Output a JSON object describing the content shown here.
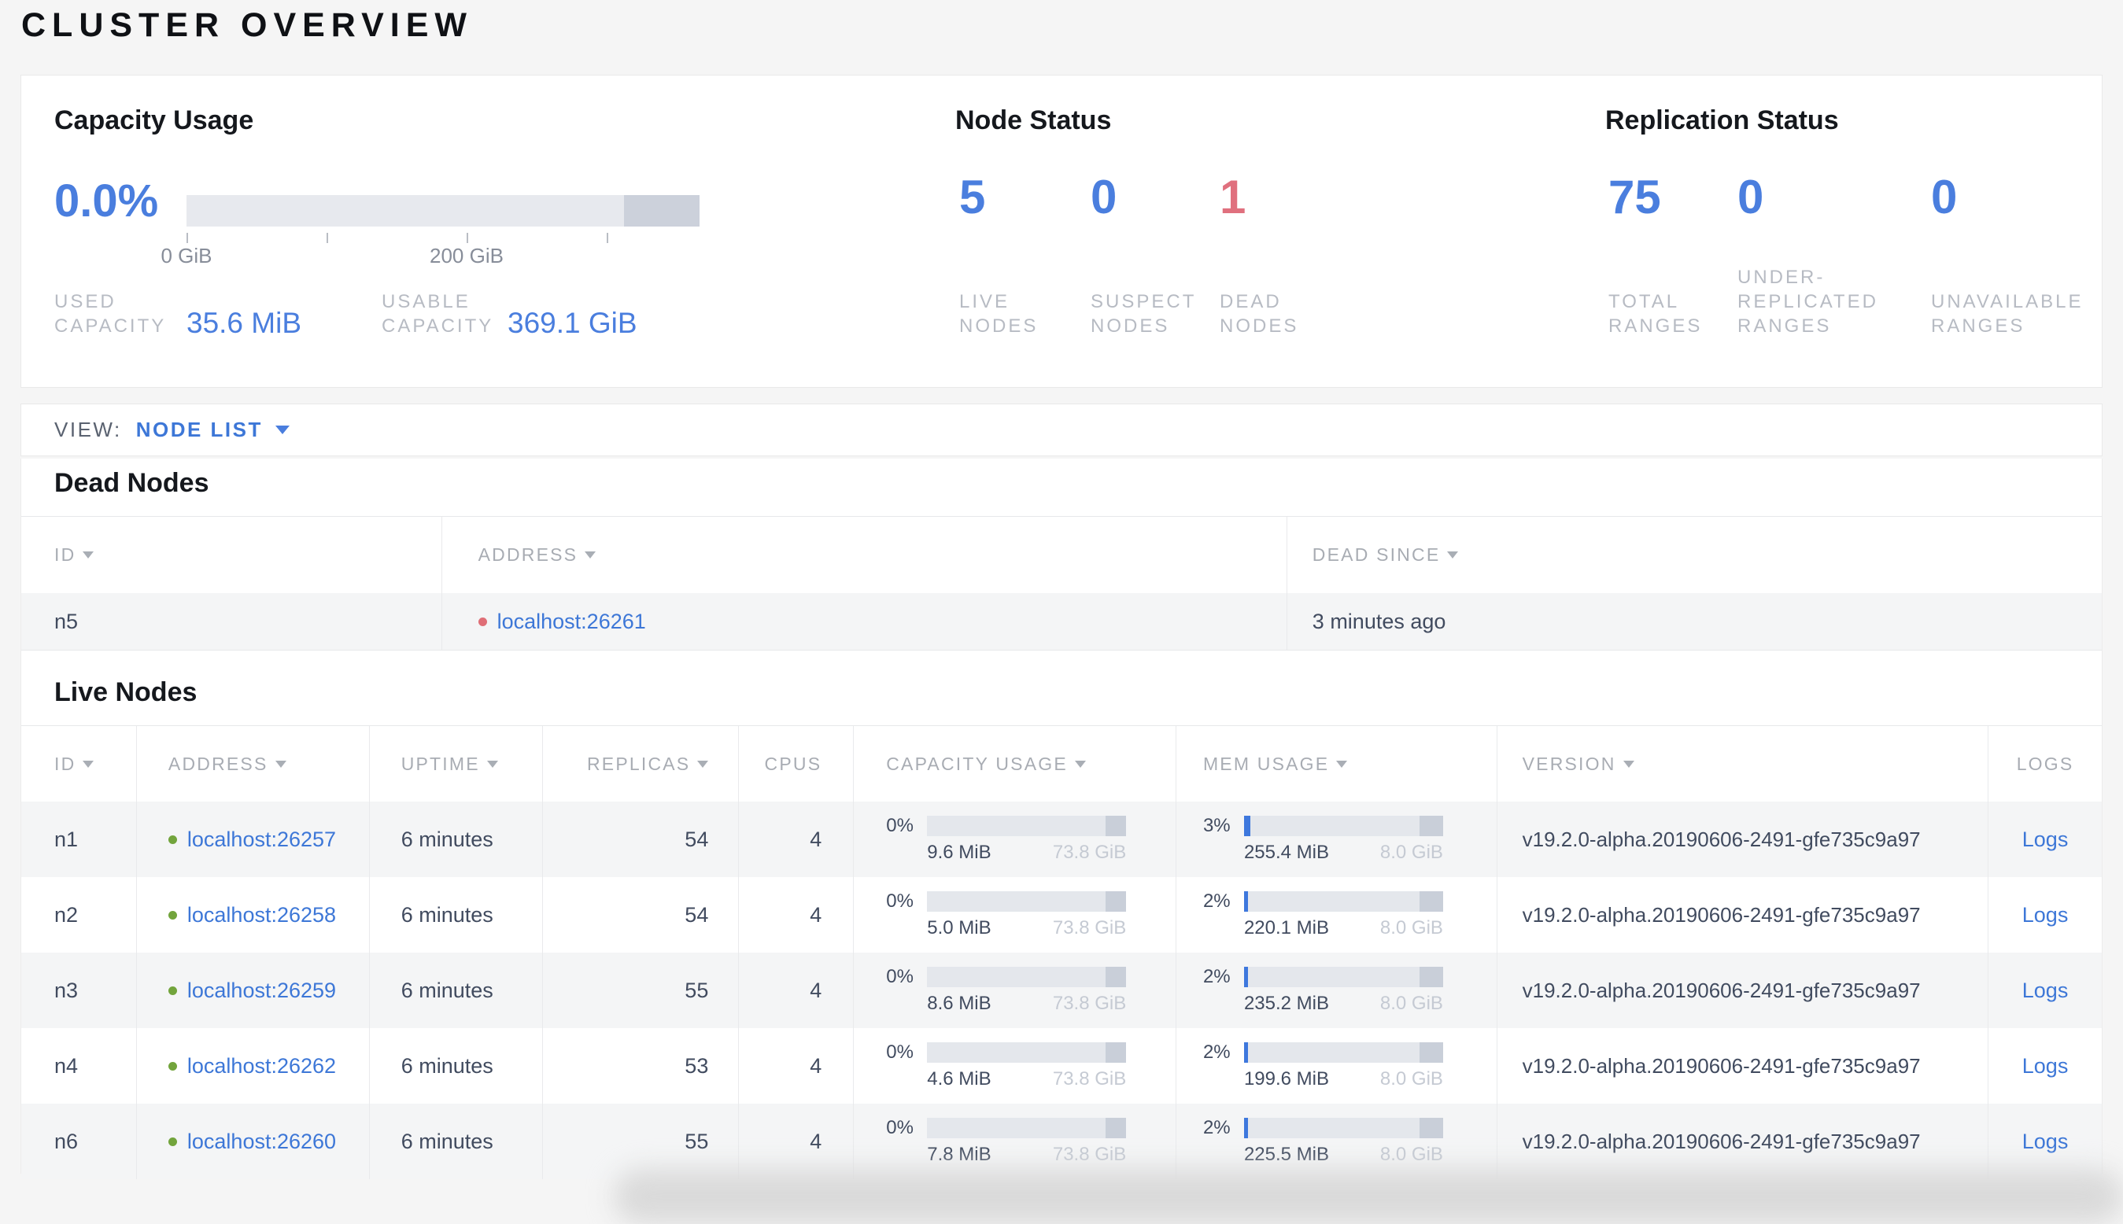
{
  "page_title": "CLUSTER OVERVIEW",
  "colors": {
    "accent_blue": "#4a7ede",
    "link_blue": "#3d77d7",
    "danger_red": "#e0707e",
    "live_green": "#72a43c",
    "bar_track": "#e4e7ec",
    "bar_dark_segment": "#ccd1db",
    "bar_fill_blue": "#3e78dd",
    "page_background": "#f5f5f5",
    "card_background": "#ffffff"
  },
  "summary": {
    "capacity": {
      "title": "Capacity Usage",
      "percent": "0.0%",
      "tick_labels": [
        "0 GiB",
        "200 GiB"
      ],
      "used_label": "USED CAPACITY",
      "used_value": "35.6 MiB",
      "usable_label": "USABLE CAPACITY",
      "usable_value": "369.1 GiB"
    },
    "node_status": {
      "title": "Node Status",
      "live": {
        "value": "5",
        "label": "LIVE NODES"
      },
      "suspect": {
        "value": "0",
        "label": "SUSPECT NODES"
      },
      "dead": {
        "value": "1",
        "label": "DEAD NODES"
      }
    },
    "replication": {
      "title": "Replication Status",
      "total": {
        "value": "75",
        "label": "TOTAL RANGES"
      },
      "under_replicated": {
        "value": "0",
        "label": "UNDER-REPLICATED RANGES"
      },
      "unavailable": {
        "value": "0",
        "label": "UNAVAILABLE RANGES"
      }
    }
  },
  "view_bar": {
    "label": "VIEW:",
    "selected": "NODE LIST"
  },
  "dead_nodes": {
    "title": "Dead Nodes",
    "columns": {
      "id": "ID",
      "address": "ADDRESS",
      "dead_since": "DEAD SINCE"
    },
    "rows": [
      {
        "id": "n5",
        "address": "localhost:26261",
        "dead_since": "3 minutes ago"
      }
    ]
  },
  "live_nodes": {
    "title": "Live Nodes",
    "columns": {
      "id": "ID",
      "address": "ADDRESS",
      "uptime": "UPTIME",
      "replicas": "REPLICAS",
      "cpus": "CPUS",
      "capacity": "CAPACITY USAGE",
      "mem": "MEM USAGE",
      "version": "VERSION",
      "logs": "LOGS"
    },
    "rows": [
      {
        "id": "n1",
        "address": "localhost:26257",
        "uptime": "6 minutes",
        "replicas": "54",
        "cpus": "4",
        "cap_pct": "0%",
        "cap_used": "9.6 MiB",
        "cap_total": "73.8 GiB",
        "mem_pct": "3%",
        "mem_used": "255.4 MiB",
        "mem_total": "8.0 GiB",
        "version": "v19.2.0-alpha.20190606-2491-gfe735c9a97",
        "logs": "Logs"
      },
      {
        "id": "n2",
        "address": "localhost:26258",
        "uptime": "6 minutes",
        "replicas": "54",
        "cpus": "4",
        "cap_pct": "0%",
        "cap_used": "5.0 MiB",
        "cap_total": "73.8 GiB",
        "mem_pct": "2%",
        "mem_used": "220.1 MiB",
        "mem_total": "8.0 GiB",
        "version": "v19.2.0-alpha.20190606-2491-gfe735c9a97",
        "logs": "Logs"
      },
      {
        "id": "n3",
        "address": "localhost:26259",
        "uptime": "6 minutes",
        "replicas": "55",
        "cpus": "4",
        "cap_pct": "0%",
        "cap_used": "8.6 MiB",
        "cap_total": "73.8 GiB",
        "mem_pct": "2%",
        "mem_used": "235.2 MiB",
        "mem_total": "8.0 GiB",
        "version": "v19.2.0-alpha.20190606-2491-gfe735c9a97",
        "logs": "Logs"
      },
      {
        "id": "n4",
        "address": "localhost:26262",
        "uptime": "6 minutes",
        "replicas": "53",
        "cpus": "4",
        "cap_pct": "0%",
        "cap_used": "4.6 MiB",
        "cap_total": "73.8 GiB",
        "mem_pct": "2%",
        "mem_used": "199.6 MiB",
        "mem_total": "8.0 GiB",
        "version": "v19.2.0-alpha.20190606-2491-gfe735c9a97",
        "logs": "Logs"
      },
      {
        "id": "n6",
        "address": "localhost:26260",
        "uptime": "6 minutes",
        "replicas": "55",
        "cpus": "4",
        "cap_pct": "0%",
        "cap_used": "7.8 MiB",
        "cap_total": "73.8 GiB",
        "mem_pct": "2%",
        "mem_used": "225.5 MiB",
        "mem_total": "8.0 GiB",
        "version": "v19.2.0-alpha.20190606-2491-gfe735c9a97",
        "logs": "Logs"
      }
    ]
  }
}
